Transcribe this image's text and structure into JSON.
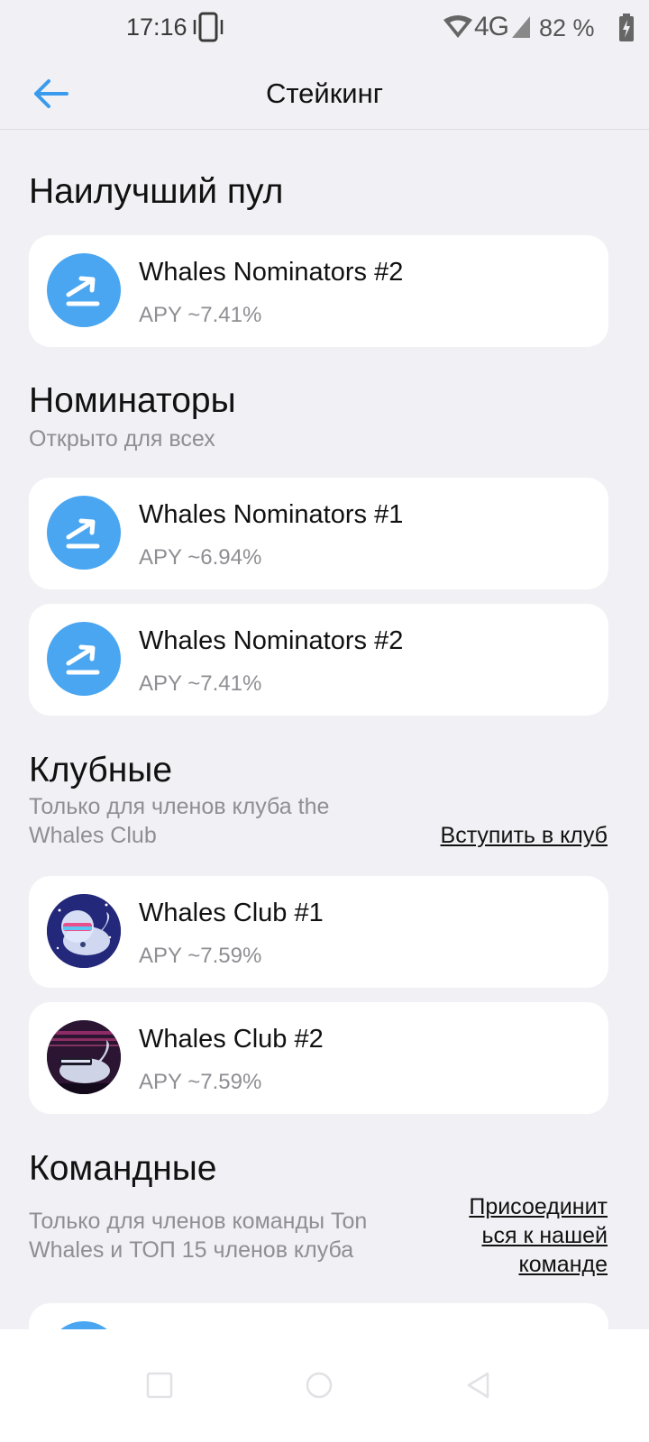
{
  "status_bar": {
    "time": "17:16",
    "network": "4G",
    "battery": "82 %"
  },
  "header": {
    "title": "Стейкинг"
  },
  "sections": {
    "best": {
      "title": "Наилучший пул",
      "pools": [
        {
          "name": "Whales Nominators #2",
          "apy": "APY ~7.41%",
          "icon": "trend-up-icon"
        }
      ]
    },
    "nominators": {
      "title": "Номинаторы",
      "subtitle": "Открыто для всех",
      "pools": [
        {
          "name": "Whales Nominators #1",
          "apy": "APY ~6.94%",
          "icon": "trend-up-icon"
        },
        {
          "name": "Whales Nominators #2",
          "apy": "APY ~7.41%",
          "icon": "trend-up-icon"
        }
      ]
    },
    "club": {
      "title": "Клубные",
      "subtitle_line1": "Только для членов клуба the",
      "subtitle_line2": "Whales Club",
      "link": "Вступить в клуб",
      "pools": [
        {
          "name": "Whales Club #1",
          "apy": "APY ~7.59%",
          "icon": "whale-astronaut-avatar"
        },
        {
          "name": "Whales Club #2",
          "apy": "APY ~7.59%",
          "icon": "whale-synthwave-avatar"
        }
      ]
    },
    "team": {
      "title": "Командные",
      "subtitle_line1": "Только для членов команды Ton",
      "subtitle_line2": "Whales и ТОП 15 членов клуба",
      "link_line1": "Присоединит",
      "link_line2": "ься к нашей",
      "link_line3": "команде"
    }
  },
  "colors": {
    "accent": "#4aa6f1",
    "background": "#f1f1f5",
    "card": "#ffffff",
    "secondary_text": "#8e8e93"
  }
}
